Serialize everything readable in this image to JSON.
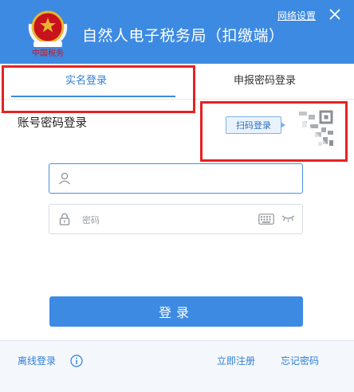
{
  "header": {
    "app_title": "自然人电子税务局（扣缴端）",
    "network_settings": "网络设置",
    "emblem_text": "中国税务",
    "colors": {
      "header_bg": "#3d8ae3",
      "emblem_red": "#c8121c",
      "emblem_gold": "#e7b631"
    }
  },
  "tabs": {
    "items": [
      {
        "label": "实名登录",
        "active": true
      },
      {
        "label": "申报密码登录",
        "active": false
      }
    ]
  },
  "login_form": {
    "section_title": "账号密码登录",
    "scan_tip": "扫码登录",
    "username": {
      "value": "",
      "placeholder": ""
    },
    "password": {
      "value": "",
      "placeholder": "密码"
    },
    "submit_label": "登录"
  },
  "footer": {
    "offline_login": "离线登录",
    "register": "立即注册",
    "forgot_password": "忘记密码"
  },
  "icons": [
    "emblem-logo",
    "close-icon",
    "qr-code-icon",
    "user-icon",
    "lock-icon",
    "keyboard-icon",
    "eye-closed-icon",
    "info-icon"
  ]
}
